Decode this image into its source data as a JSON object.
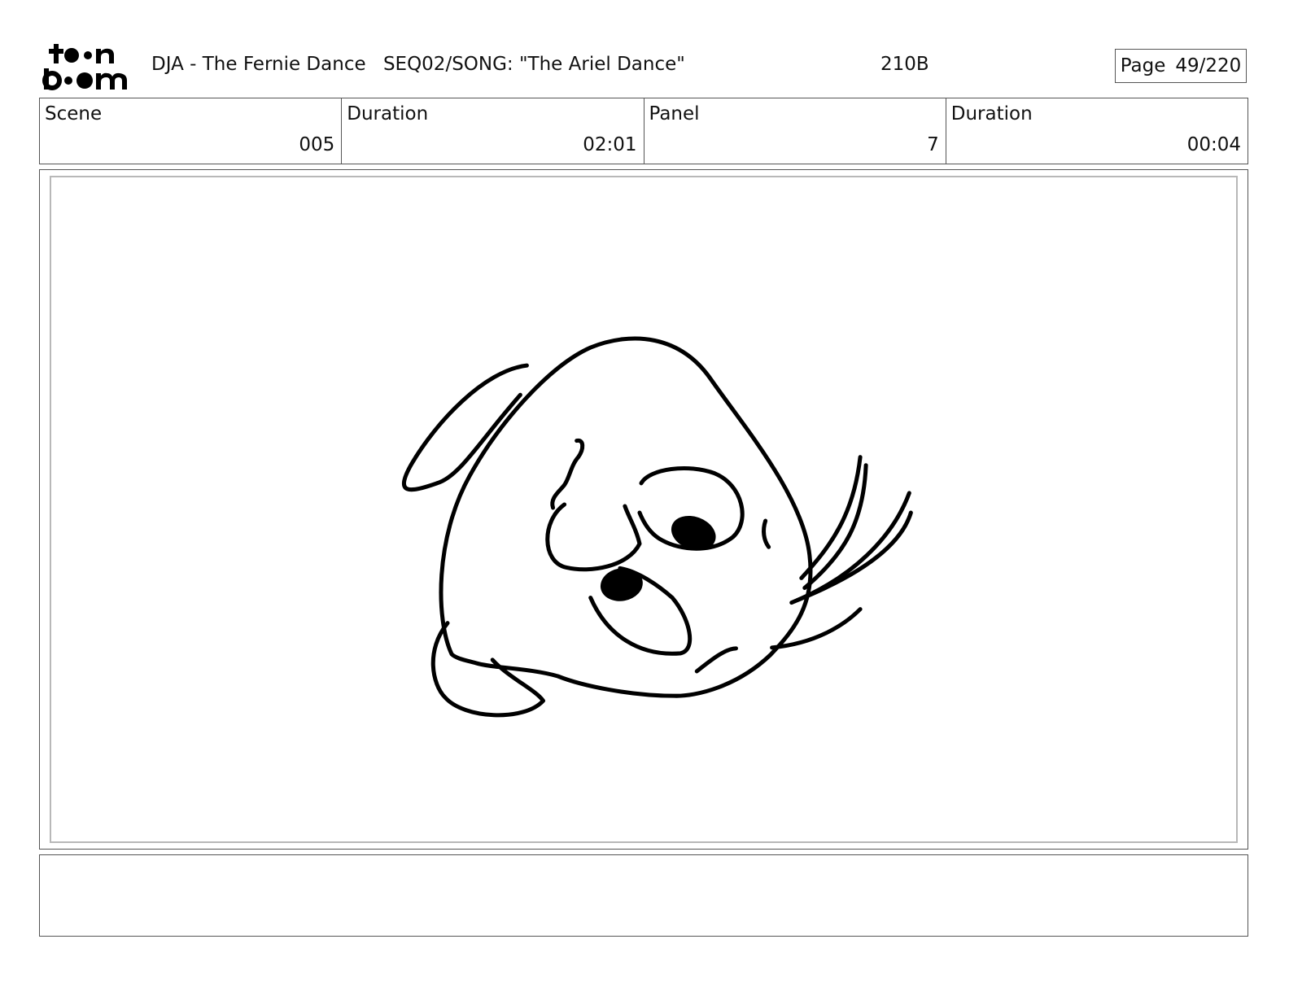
{
  "header": {
    "logo_text": "toonboom",
    "project": "DJA - The Fernie Dance",
    "sequence": "SEQ02/SONG: \"The Ariel Dance\"",
    "code": "210B",
    "page_label": "Page",
    "page_value": "49/220"
  },
  "info": {
    "scene_label": "Scene",
    "scene_value": "005",
    "scene_duration_label": "Duration",
    "scene_duration_value": "02:01",
    "panel_label": "Panel",
    "panel_value": "7",
    "panel_duration_label": "Duration",
    "panel_duration_value": "00:04"
  },
  "notes": {
    "text": ""
  }
}
